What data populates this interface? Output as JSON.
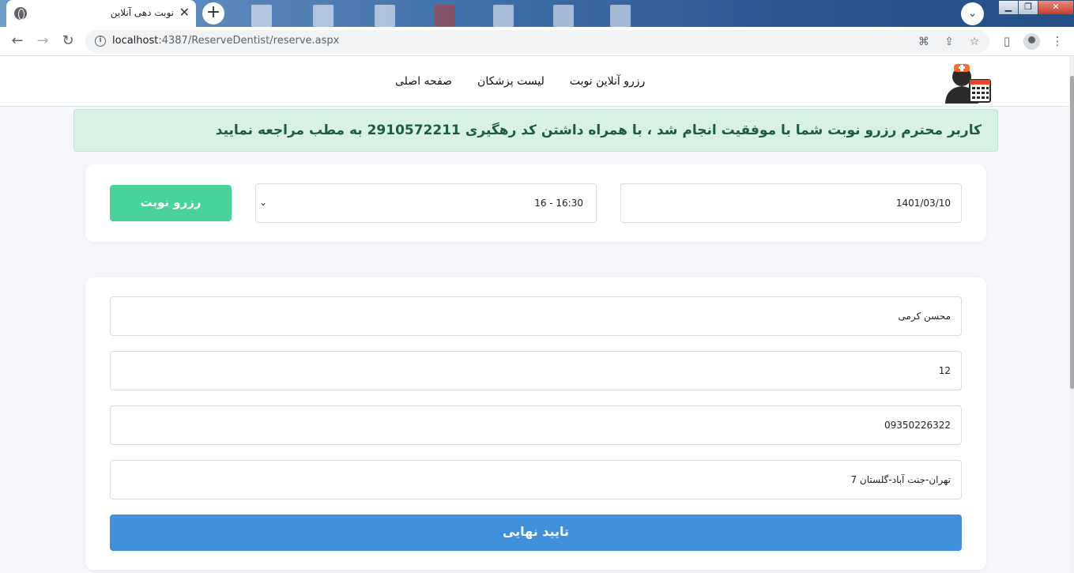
{
  "browser": {
    "tab_title": "نوبت دهی آنلاین",
    "tab_close": "✕",
    "new_tab": "+",
    "url_host": "localhost",
    "url_rest": ":4387/ReserveDentist/reserve.aspx"
  },
  "header": {
    "nav": [
      "صفحه اصلی",
      "لیست پزشکان",
      "رزرو آنلاین نوبت"
    ]
  },
  "alert": {
    "message": "کاربر محترم رزرو نوبت شما با موفقیت انجام شد ، با همراه داشتن کد رهگیری 2910572211 به مطب مراجعه نمایید"
  },
  "reserve": {
    "date": "1401/03/10",
    "time_slot": "16 - 16:30",
    "button": "رزرو نوبت"
  },
  "form": {
    "name": "محسن کرمی",
    "field2": "12",
    "phone": "09350226322",
    "address": "تهران-جنت آباد-گلستان 7",
    "submit": "تایید نهایی"
  },
  "colors": {
    "alert_bg": "#d7f2e5",
    "alert_text": "#1d5c3f",
    "reserve_button": "#48d39b",
    "submit_button": "#4190da"
  }
}
